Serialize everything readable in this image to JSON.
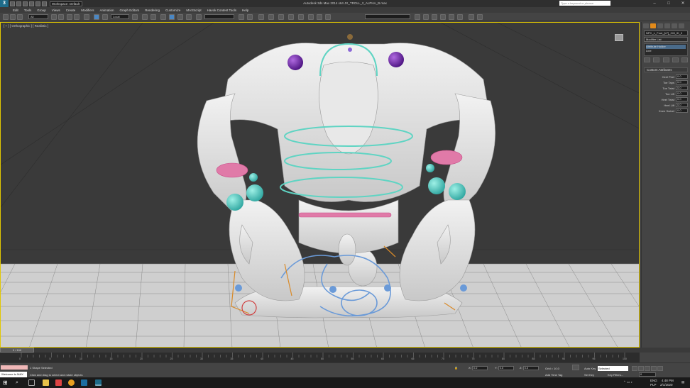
{
  "window": {
    "title": "Autodesk 3ds Max 2014 x64     JX_TROLL_2_ALPHA_B.max",
    "workspace": "Workspace: Default",
    "search_placeholder": "Type a keyword or phrase",
    "minimize": "–",
    "maximize": "□",
    "close": "✕"
  },
  "menu": [
    "Edit",
    "Tools",
    "Group",
    "Views",
    "Create",
    "Modifiers",
    "Animation",
    "Graph Editors",
    "Rendering",
    "Customize",
    "MAXScript",
    "Havok Content Tools",
    "Help"
  ],
  "toolbar": {
    "selection_filter": "All",
    "ref_coord": "Local",
    "named_selection": ""
  },
  "viewport": {
    "label": "[ + ] [ Orthographic ] [ Realistic ]"
  },
  "command_panel": {
    "object_name": "NPC_L_Foot_[LF]_CM_IK_0",
    "modifier_list": "Modifier List",
    "stack": [
      "Attribute Holder",
      "Line"
    ],
    "rollout_title": "Custom Attributes",
    "attributes": [
      {
        "label": "Heel Peel",
        "value": "0.0"
      },
      {
        "label": "Toe Taps",
        "value": "0.0"
      },
      {
        "label": "Toe Twist",
        "value": "0.0"
      },
      {
        "label": "Toe Lift",
        "value": "0.0"
      },
      {
        "label": "Heel Twist",
        "value": "0.0"
      },
      {
        "label": "Heel Lift",
        "value": "0.0"
      },
      {
        "label": "Knee Swivel",
        "value": "0.0"
      }
    ]
  },
  "timeline": {
    "slider": "0 / 100",
    "ticks": [
      "0",
      "5",
      "10",
      "15",
      "20",
      "25",
      "30",
      "35",
      "40",
      "45",
      "50",
      "55",
      "60",
      "65",
      "70",
      "75",
      "80",
      "85",
      "90",
      "95",
      "100"
    ]
  },
  "status": {
    "selection": "1 Shape Selected",
    "prompt": "Click and drag to select and rotate objects",
    "welcome": "Welcome to MAX",
    "x_label": "X:",
    "x_value": "0.0",
    "y_label": "Y:",
    "y_value": "0.0",
    "z_label": "Z:",
    "z_value": "0.0",
    "grid": "Grid = 10.0",
    "add_time_tag": "Add Time Tag",
    "auto_key": "Auto Key",
    "set_key": "Set Key",
    "key_mode": "Selected",
    "key_filters": "Key Filters...",
    "frame": "0"
  },
  "taskbar": {
    "lang": "ENG",
    "lang2": "PLP",
    "time": "4:48 PM",
    "date": "2/1/2020"
  },
  "colors": {
    "viewport_border": "#e2c800",
    "modify_tab": "#e28a1a",
    "helper_cyan": "#5fd4c3",
    "helper_pink": "#e07aa8",
    "helper_purple": "#7a2fb0",
    "helper_blue": "#6a9ad8",
    "helper_orange": "#d98a28"
  }
}
